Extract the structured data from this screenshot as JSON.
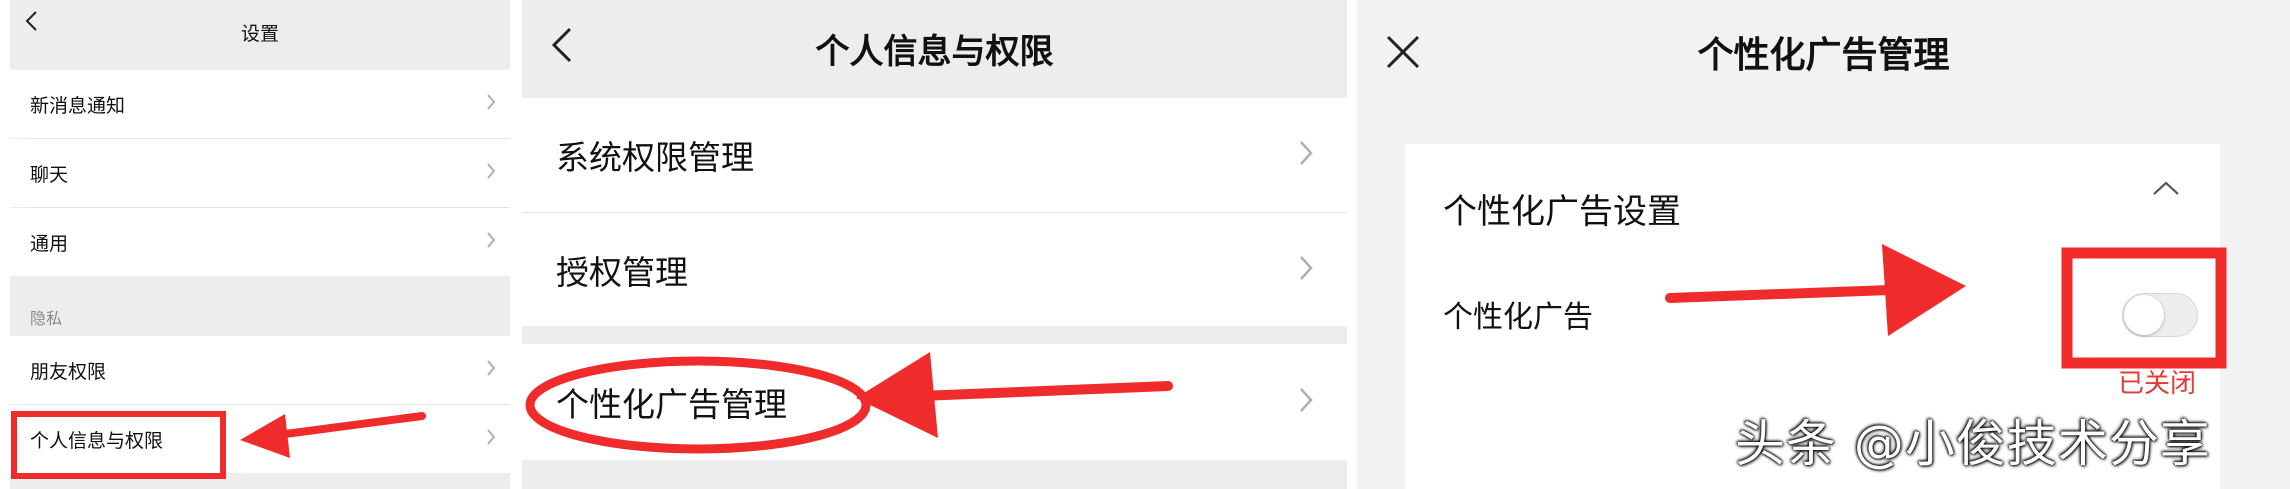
{
  "panel1": {
    "title": "设置",
    "items": [
      {
        "label": "新消息通知"
      },
      {
        "label": "聊天"
      },
      {
        "label": "通用"
      }
    ],
    "section_label": "隐私",
    "privacy_items": [
      {
        "label": "朋友权限"
      },
      {
        "label": "个人信息与权限"
      }
    ]
  },
  "panel2": {
    "title": "个人信息与权限",
    "items": [
      {
        "label": "系统权限管理"
      },
      {
        "label": "授权管理"
      },
      {
        "label": "个性化广告管理"
      }
    ]
  },
  "panel3": {
    "title": "个性化广告管理",
    "card_title": "个性化广告设置",
    "row_label": "个性化广告",
    "toggle_on": false,
    "status": "已关闭"
  },
  "watermark": "头条 @小俊技术分享",
  "colors": {
    "annotation_red": "#ef2b2b",
    "status_red": "#e53935",
    "background": "#ededed"
  }
}
